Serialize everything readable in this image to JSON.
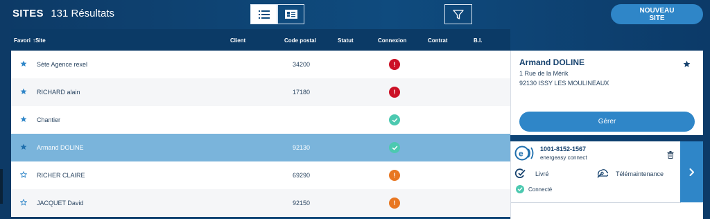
{
  "header": {
    "title": "SITES",
    "count": "131 Résultats",
    "new_site_label": "NOUVEAU\nSITE"
  },
  "table": {
    "columns": {
      "favori": "Favori",
      "site": "↑Site",
      "client": "Client",
      "code_postal": "Code postal",
      "statut": "Statut",
      "connexion": "Connexion",
      "contrat": "Contrat",
      "bi": "B.I."
    },
    "rows": [
      {
        "favorite": true,
        "site": "Sète Agence rexel",
        "code_postal": "34200",
        "connexion": "error"
      },
      {
        "favorite": true,
        "site": "RICHARD alain",
        "code_postal": "17180",
        "connexion": "error"
      },
      {
        "favorite": true,
        "site": "Chantier",
        "code_postal": "",
        "connexion": "ok"
      },
      {
        "favorite": true,
        "site": "Armand DOLINE",
        "code_postal": "92130",
        "connexion": "ok",
        "selected": true
      },
      {
        "favorite": false,
        "site": "RICHER CLAIRE",
        "code_postal": "69290",
        "connexion": "warn"
      },
      {
        "favorite": false,
        "site": "JACQUET David",
        "code_postal": "92150",
        "connexion": "warn"
      }
    ]
  },
  "detail": {
    "name": "Armand DOLINE",
    "address_line1": "1 Rue de la Mérik",
    "address_line2": "92130 ISSY LES MOULINEAUX",
    "manage_label": "Gérer",
    "device": {
      "id": "1001-8152-1567",
      "type": "energeasy connect",
      "livre": "Livré",
      "telemaintenance": "Télémaintenance",
      "status": "Connecté"
    }
  },
  "colors": {
    "background": "#0f4b7e",
    "accent": "#2f86c8",
    "selected_row": "#7ab4db",
    "error": "#cc1126",
    "ok": "#4cc9b0",
    "warn": "#e87722"
  }
}
